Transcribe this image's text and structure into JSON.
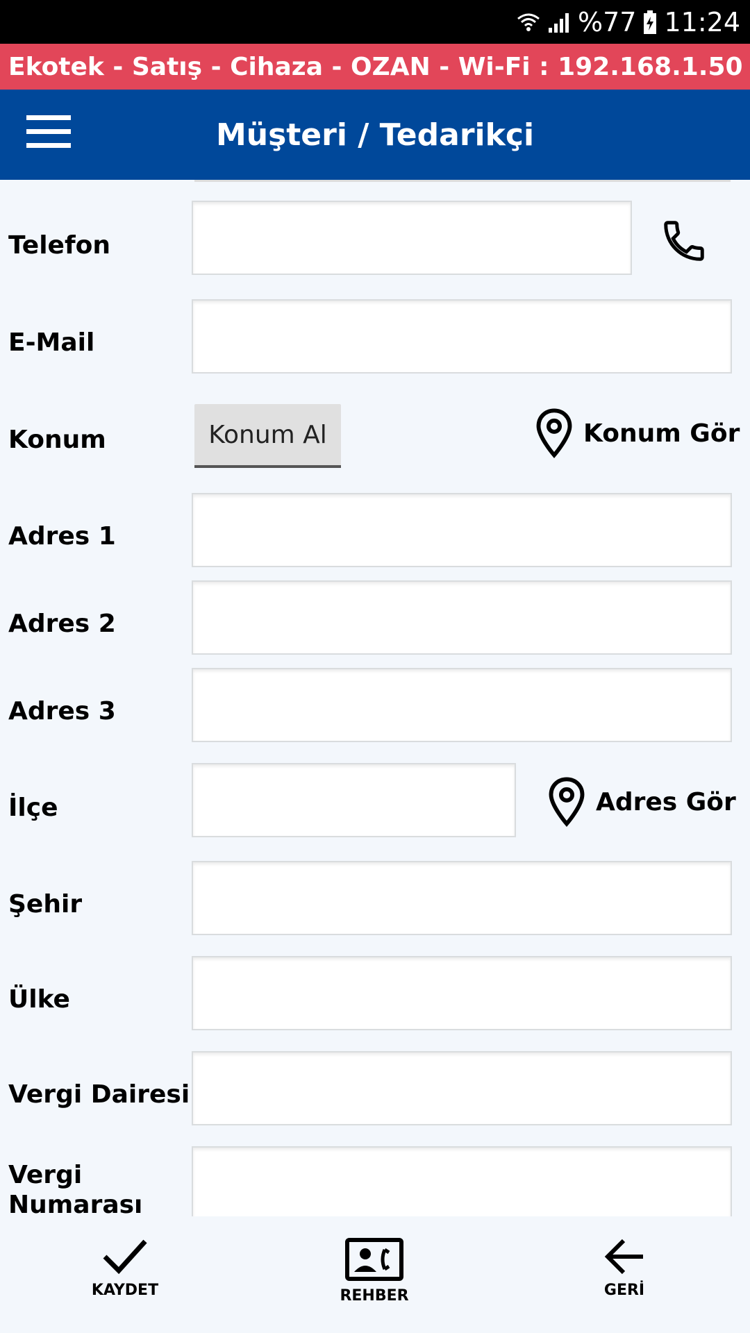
{
  "status_bar": {
    "battery": "%77",
    "time": "11:24"
  },
  "info_bar": {
    "text": "Ekotek - Satış - Cihaza - OZAN - Wi-Fi : 192.168.1.50"
  },
  "app_bar": {
    "title": "Müşteri / Tedarikçi",
    "menu_icon": "hamburger-menu-icon"
  },
  "form": {
    "telefon_label": "Telefon",
    "telefon_value": "",
    "email_label": "E-Mail",
    "email_value": "",
    "konum_label": "Konum",
    "konum_al_button": "Konum Al",
    "konum_gor_button": "Konum Gör",
    "adres1_label": "Adres 1",
    "adres1_value": "",
    "adres2_label": "Adres 2",
    "adres2_value": "",
    "adres3_label": "Adres 3",
    "adres3_value": "",
    "ilce_label": "İlçe",
    "ilce_value": "",
    "adres_gor_button": "Adres Gör",
    "sehir_label": "Şehir",
    "sehir_value": "",
    "ulke_label": "Ülke",
    "ulke_value": "",
    "vergi_dairesi_label": "Vergi Dairesi",
    "vergi_dairesi_value": "",
    "vergi_numarasi_label_line1": "Vergi",
    "vergi_numarasi_label_line2": "Numarası",
    "vergi_numarasi_value": ""
  },
  "bottom_nav": {
    "kaydet": "KAYDET",
    "rehber": "REHBER",
    "geri": "GERİ"
  }
}
